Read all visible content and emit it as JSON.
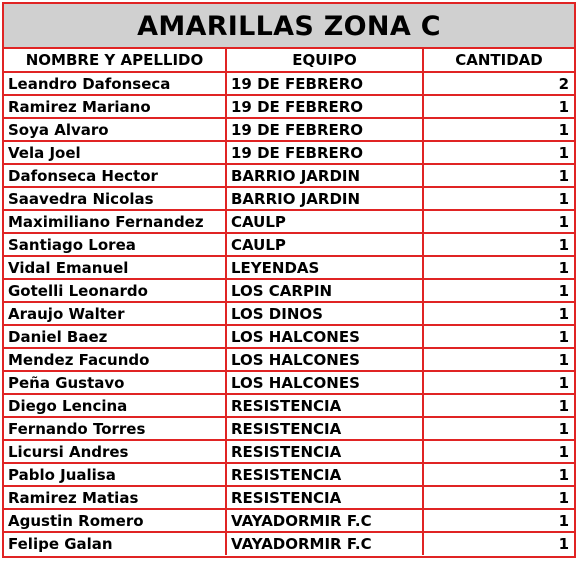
{
  "title": "AMARILLAS ZONA C",
  "columns": {
    "name": "NOMBRE Y APELLIDO",
    "team": "EQUIPO",
    "qty": "CANTIDAD"
  },
  "rows": [
    {
      "name": "Leandro Dafonseca",
      "team": "19 DE FEBRERO",
      "qty": "2"
    },
    {
      "name": "Ramirez Mariano",
      "team": "19 DE FEBRERO",
      "qty": "1"
    },
    {
      "name": "Soya Alvaro",
      "team": "19 DE FEBRERO",
      "qty": "1"
    },
    {
      "name": "Vela Joel",
      "team": "19 DE FEBRERO",
      "qty": "1"
    },
    {
      "name": "Dafonseca Hector",
      "team": "BARRIO JARDIN",
      "qty": "1"
    },
    {
      "name": "Saavedra Nicolas",
      "team": "BARRIO JARDIN",
      "qty": "1"
    },
    {
      "name": "Maximiliano Fernandez",
      "team": "CAULP",
      "qty": "1"
    },
    {
      "name": "Santiago Lorea",
      "team": "CAULP",
      "qty": "1"
    },
    {
      "name": "Vidal Emanuel",
      "team": "LEYENDAS",
      "qty": "1"
    },
    {
      "name": "Gotelli Leonardo",
      "team": "LOS CARPIN",
      "qty": "1"
    },
    {
      "name": "Araujo Walter",
      "team": "LOS DINOS",
      "qty": "1"
    },
    {
      "name": "Daniel Baez",
      "team": "LOS HALCONES",
      "qty": "1"
    },
    {
      "name": "Mendez Facundo",
      "team": "LOS HALCONES",
      "qty": "1"
    },
    {
      "name": "Peña Gustavo",
      "team": "LOS HALCONES",
      "qty": "1"
    },
    {
      "name": "Diego Lencina",
      "team": "RESISTENCIA",
      "qty": "1"
    },
    {
      "name": "Fernando Torres",
      "team": "RESISTENCIA",
      "qty": "1"
    },
    {
      "name": "Licursi Andres",
      "team": "RESISTENCIA",
      "qty": "1"
    },
    {
      "name": "Pablo Jualisa",
      "team": "RESISTENCIA",
      "qty": "1"
    },
    {
      "name": "Ramirez Matias",
      "team": "RESISTENCIA",
      "qty": "1"
    },
    {
      "name": "Agustin Romero",
      "team": "VAYADORMIR F.C",
      "qty": "1"
    },
    {
      "name": "Felipe Galan",
      "team": "VAYADORMIR F.C",
      "qty": "1"
    }
  ]
}
